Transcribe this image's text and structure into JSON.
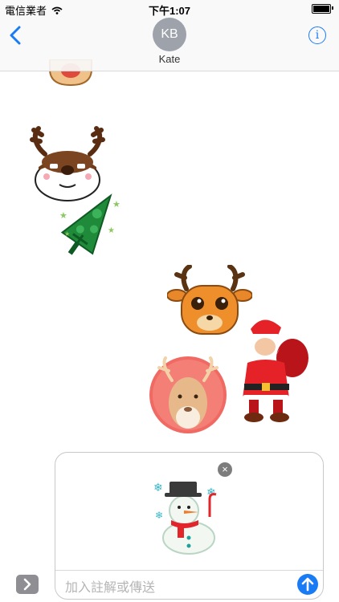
{
  "status_bar": {
    "carrier": "電信業者",
    "time": "下午1:07"
  },
  "header": {
    "avatar_initials": "KB",
    "contact_name": "Kate",
    "info_glyph": "i"
  },
  "compose": {
    "placeholder": "加入註解或傳送",
    "remove_glyph": "×"
  },
  "stickers": [
    {
      "name": "reindeer-sticker-partial"
    },
    {
      "name": "reindeer-head-sticker"
    },
    {
      "name": "christmas-tree-sticker"
    },
    {
      "name": "deer-face-sticker"
    },
    {
      "name": "santa-claus-sticker"
    },
    {
      "name": "reindeer-circle-sticker"
    },
    {
      "name": "snowman-sticker"
    }
  ],
  "colors": {
    "accent": "#1a7cf5",
    "avatar_bg": "#9ea3ab"
  }
}
